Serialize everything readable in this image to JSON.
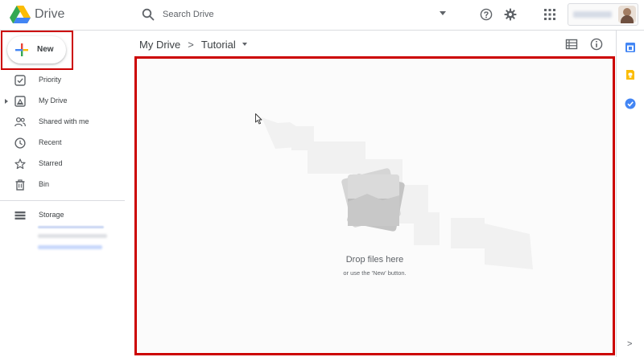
{
  "header": {
    "app_title": "Drive",
    "search_placeholder": "Search Drive",
    "logo_icon": "google-drive-logo",
    "icons": [
      "search-icon",
      "search-options-icon",
      "help-icon",
      "settings-icon",
      "apps-icon"
    ]
  },
  "sidebar": {
    "new_label": "New",
    "items": [
      {
        "label": "Priority",
        "icon": "priority-icon"
      },
      {
        "label": "My Drive",
        "icon": "my-drive-icon"
      },
      {
        "label": "Shared with me",
        "icon": "shared-icon"
      },
      {
        "label": "Recent",
        "icon": "clock-icon"
      },
      {
        "label": "Starred",
        "icon": "star-icon"
      },
      {
        "label": "Bin",
        "icon": "trash-icon"
      }
    ],
    "storage_label": "Storage"
  },
  "main": {
    "breadcrumb": [
      "My Drive",
      "Tutorial"
    ],
    "breadcrumb_separator": ">",
    "drop_title": "Drop files here",
    "drop_subtitle": "or use the 'New' button."
  },
  "rail": {
    "icons": [
      "calendar-icon",
      "keep-icon",
      "tasks-icon"
    ],
    "expand_glyph": ">"
  },
  "colors": {
    "highlight": "#cc0000",
    "text": "#3c4043",
    "secondary": "#5f6368",
    "divider": "#dadce0",
    "google_blue": "#4285f4",
    "google_red": "#ea4335",
    "google_yellow": "#fbbc04",
    "google_green": "#34a853"
  }
}
